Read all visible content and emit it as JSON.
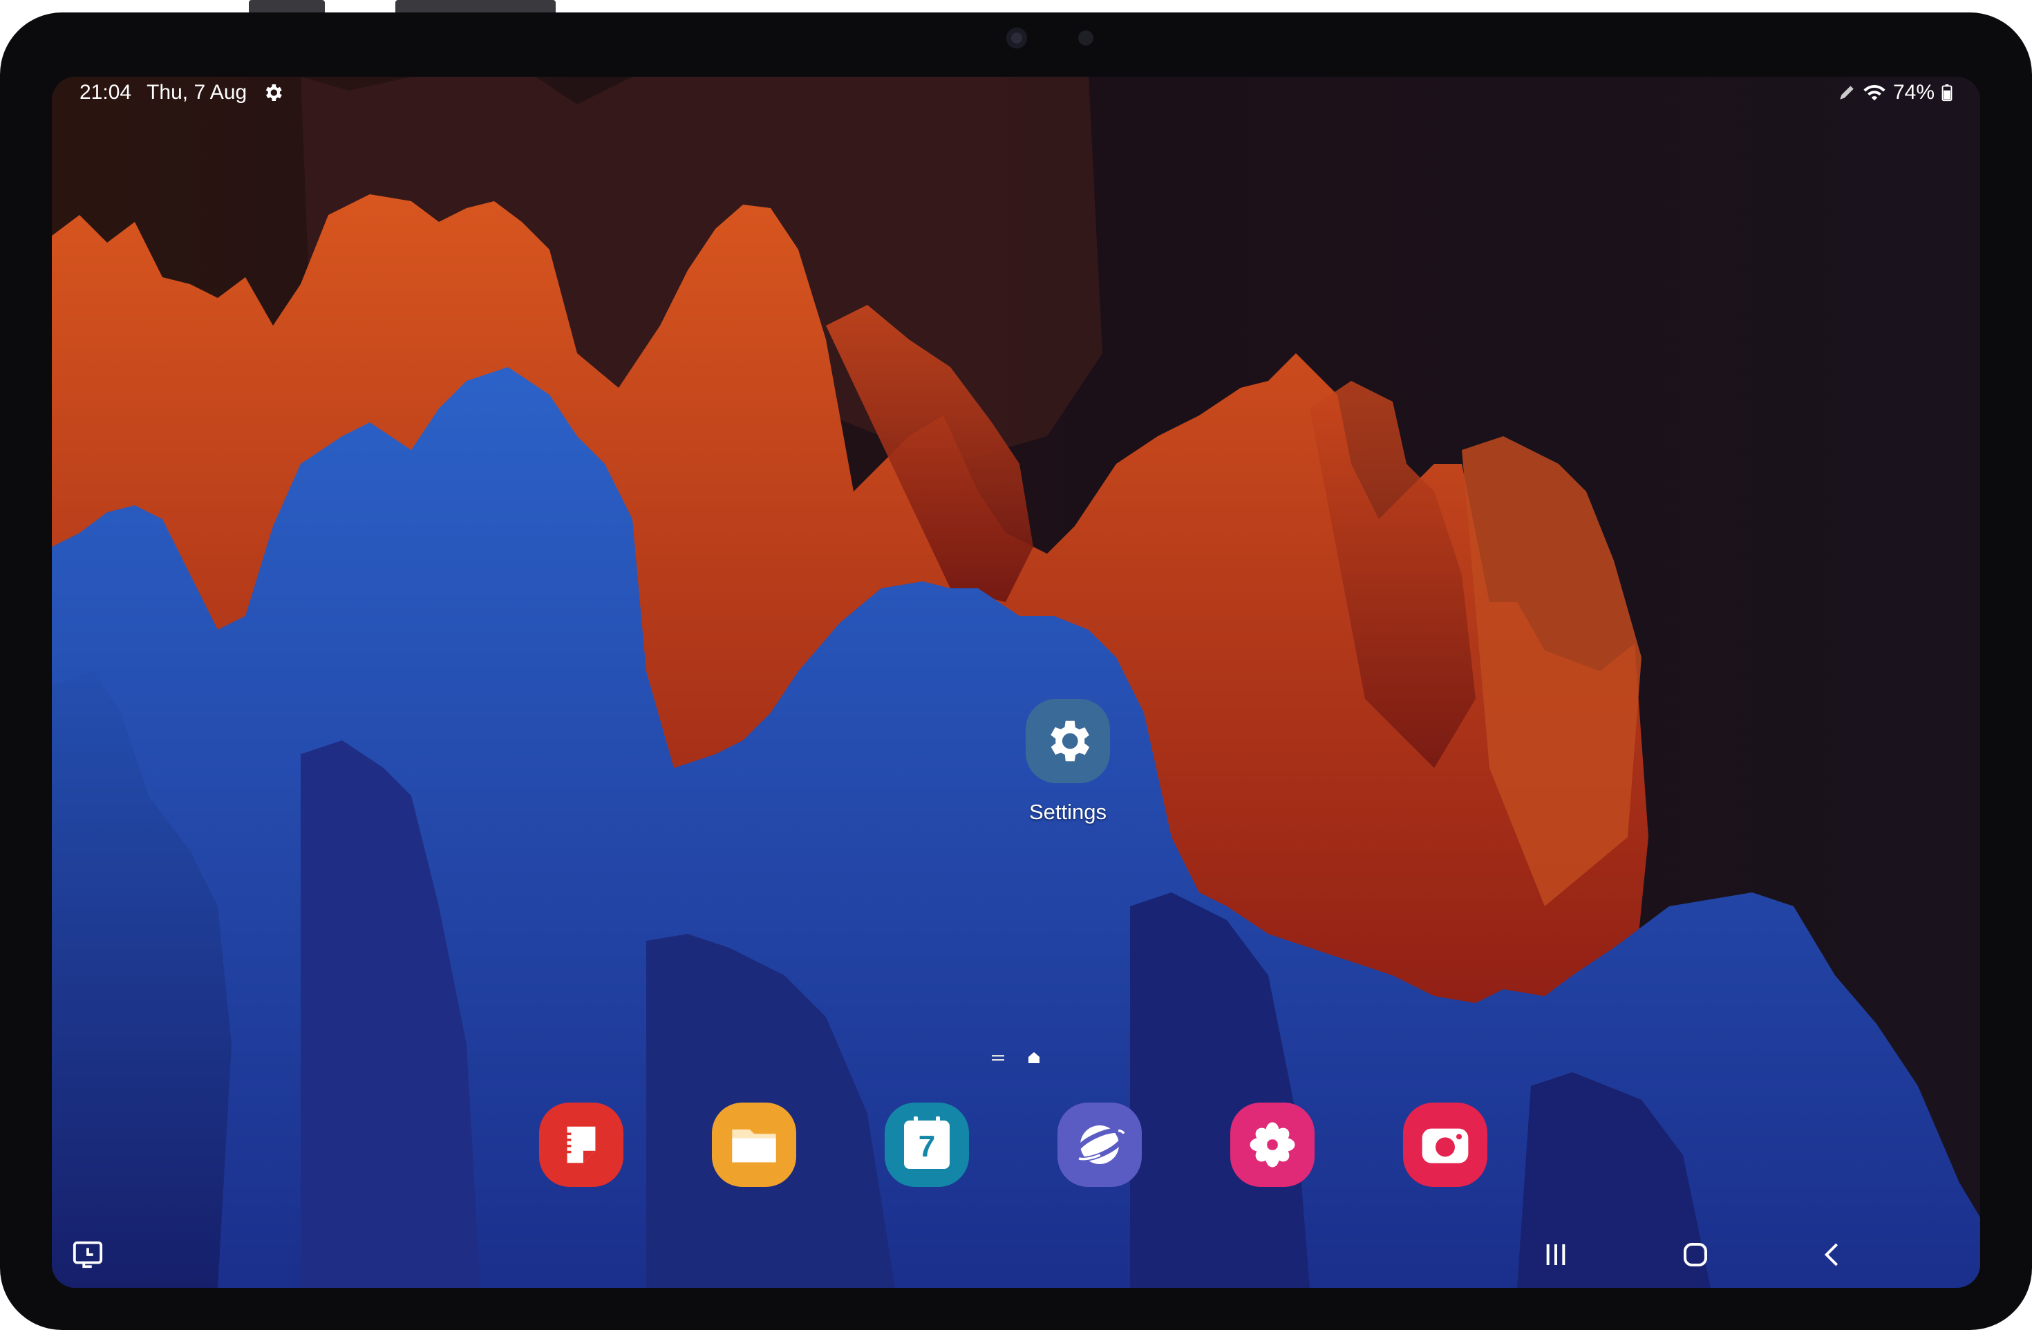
{
  "status_bar": {
    "time": "21:04",
    "date": "Thu, 7 Aug",
    "battery": "74%",
    "icons": [
      "gear-icon",
      "pen-icon",
      "wifi-icon",
      "battery-charging-icon"
    ]
  },
  "home": {
    "shortcut": {
      "label": "Settings",
      "icon": "gear-icon",
      "color": "#3a6a98"
    },
    "page_indicator": [
      "menu-lines-icon",
      "home-dot-icon"
    ],
    "dock": [
      {
        "name": "notes",
        "icon": "notes-icon",
        "color": "#e0302c"
      },
      {
        "name": "files",
        "icon": "folder-icon",
        "color": "#f0a32c"
      },
      {
        "name": "calendar",
        "icon": "calendar-icon",
        "day": "7",
        "color": "#1487a8"
      },
      {
        "name": "internet",
        "icon": "planet-icon",
        "color": "#5b5bc4"
      },
      {
        "name": "gallery",
        "icon": "flower-icon",
        "color": "#e02a78"
      },
      {
        "name": "camera",
        "icon": "camera-icon",
        "color": "#e4244e"
      }
    ]
  },
  "nav": {
    "buttons": [
      "screenshot-icon",
      "recents-icon",
      "home-icon",
      "back-icon"
    ]
  }
}
